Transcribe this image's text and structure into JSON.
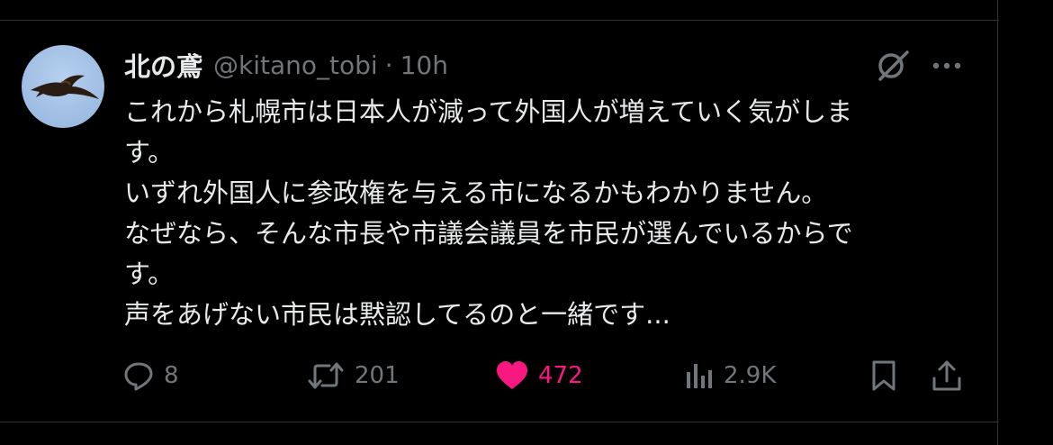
{
  "tweet": {
    "author_name": "北の鳶",
    "handle": "@kitano_tobi",
    "separator": "·",
    "time": "10h",
    "text_lines": [
      "これから札幌市は日本人が減って外国人が増えていく気がしま",
      "す。",
      "いずれ外国人に参政権を与える市になるかもわかりません。",
      "なぜなら、そんな市長や市議会議員を市民が選んでいるからで",
      "す。",
      "声をあげない市民は黙認してるのと一緒です..."
    ]
  },
  "actions": {
    "reply_count": "8",
    "retweet_count": "201",
    "like_count": "472",
    "views_count": "2.9K"
  },
  "icons": {
    "avatar": "kite-bird-avatar",
    "grok": "grok-icon",
    "more": "more-icon",
    "reply": "reply-icon",
    "retweet": "retweet-icon",
    "like": "heart-icon",
    "views": "views-icon",
    "bookmark": "bookmark-icon",
    "share": "share-icon"
  },
  "colors": {
    "background": "#000000",
    "text": "#e7e9ea",
    "muted": "#71767b",
    "like": "#f91880",
    "divider": "#2f3336"
  }
}
